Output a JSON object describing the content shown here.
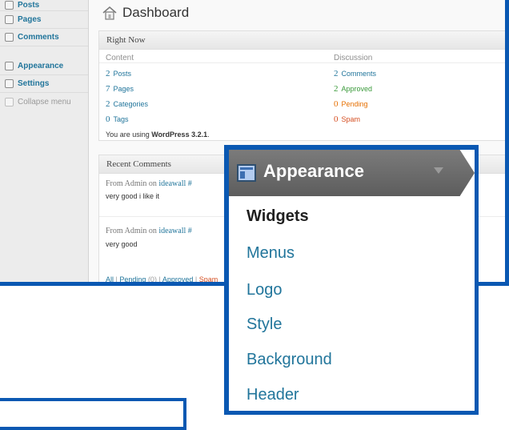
{
  "sidebar": {
    "items": [
      {
        "label": "Posts"
      },
      {
        "label": "Pages"
      },
      {
        "label": "Comments"
      },
      {
        "label": "Appearance"
      },
      {
        "label": "Settings"
      }
    ],
    "collapse_label": "Collapse menu"
  },
  "page": {
    "title": "Dashboard"
  },
  "right_now": {
    "title": "Right Now",
    "content_heading": "Content",
    "discussion_heading": "Discussion",
    "content": [
      {
        "count": "2",
        "label": "Posts"
      },
      {
        "count": "7",
        "label": "Pages"
      },
      {
        "count": "2",
        "label": "Categories"
      },
      {
        "count": "0",
        "label": "Tags"
      }
    ],
    "discussion": [
      {
        "count": "2",
        "label": "Comments"
      },
      {
        "count": "2",
        "label": "Approved"
      },
      {
        "count": "0",
        "label": "Pending"
      },
      {
        "count": "0",
        "label": "Spam"
      }
    ],
    "version_prefix": "You are using ",
    "version": "WordPress 3.2.1",
    "version_suffix": "."
  },
  "recent_comments": {
    "title": "Recent Comments",
    "comments": [
      {
        "from": "From Admin on ",
        "link": "ideawall #",
        "text": "very good i like it"
      },
      {
        "from": "From Admin on ",
        "link": "ideawall #",
        "text": "very good"
      }
    ],
    "filters": {
      "all": "All",
      "pending": "Pending",
      "pending_count": "(0)",
      "approved": "Approved",
      "spam": "Spam",
      "separator": "|"
    }
  },
  "appearance_menu": {
    "title": "Appearance",
    "items": [
      {
        "label": "Widgets"
      },
      {
        "label": "Menus"
      },
      {
        "label": "Logo"
      },
      {
        "label": "Style"
      },
      {
        "label": "Background"
      },
      {
        "label": "Header"
      }
    ]
  },
  "colors": {
    "frame": "#0a58b2",
    "link": "#21759b",
    "approved": "#3a9a3a",
    "pending": "#e66f00",
    "spam": "#d54e21"
  }
}
